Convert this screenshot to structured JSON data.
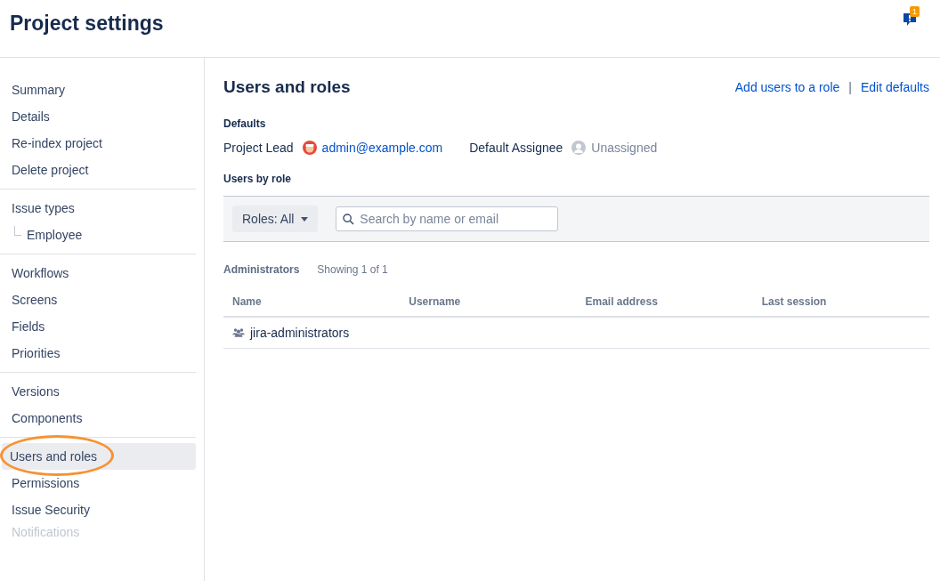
{
  "header": {
    "title": "Project settings",
    "feedback_badge": "1"
  },
  "sidebar": {
    "groups": [
      {
        "items": [
          {
            "label": "Summary",
            "selected": false
          },
          {
            "label": "Details",
            "selected": false
          },
          {
            "label": "Re-index project",
            "selected": false
          },
          {
            "label": "Delete project",
            "selected": false
          }
        ]
      },
      {
        "items": [
          {
            "label": "Issue types",
            "selected": false,
            "children": [
              {
                "label": "Employee",
                "selected": false
              }
            ]
          }
        ]
      },
      {
        "items": [
          {
            "label": "Workflows",
            "selected": false
          },
          {
            "label": "Screens",
            "selected": false
          },
          {
            "label": "Fields",
            "selected": false
          },
          {
            "label": "Priorities",
            "selected": false
          }
        ]
      },
      {
        "items": [
          {
            "label": "Versions",
            "selected": false
          },
          {
            "label": "Components",
            "selected": false
          }
        ]
      },
      {
        "items": [
          {
            "label": "Users and roles",
            "selected": true,
            "highlighted": true
          },
          {
            "label": "Permissions",
            "selected": false
          },
          {
            "label": "Issue Security",
            "selected": false
          },
          {
            "label": "Notifications",
            "selected": false,
            "faded": true
          }
        ]
      }
    ]
  },
  "main": {
    "title": "Users and roles",
    "actions": [
      "Add users to a role",
      "Edit defaults"
    ],
    "separator": "|",
    "defaults": {
      "heading": "Defaults",
      "project_lead_label": "Project Lead",
      "project_lead": "admin@example.com",
      "assignee_label": "Default Assignee",
      "assignee": "Unassigned"
    },
    "users_heading": "Users by role",
    "filter": {
      "roles_button": "Roles: All",
      "search": {
        "placeholder": "Search by name or email"
      }
    },
    "role": {
      "name": "Administrators",
      "count": "Showing 1 of 1"
    },
    "table": {
      "columns": [
        "Name",
        "Username",
        "Email address",
        "Last session"
      ],
      "rows": [
        {
          "kind": "group",
          "cells": [
            "jira-administrators",
            "",
            "",
            ""
          ]
        }
      ]
    }
  }
}
